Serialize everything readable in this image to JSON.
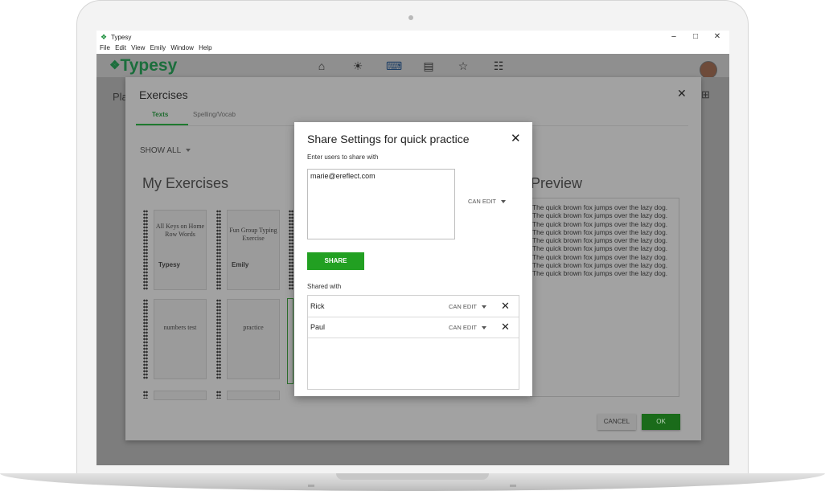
{
  "window": {
    "title": "Typesy",
    "menu": [
      "File",
      "Edit",
      "View",
      "Emily",
      "Window",
      "Help"
    ],
    "controls": {
      "minimize": "−",
      "maximize": "□",
      "close": "✕"
    }
  },
  "app": {
    "logo": "Typesy",
    "nav_icons": [
      "home-icon",
      "lightbulb-icon",
      "keyboard-icon",
      "chart-icon",
      "star-icon",
      "clipboard-icon"
    ],
    "page_title_partial": "Pla"
  },
  "exercises": {
    "title": "Exercises",
    "tabs": [
      "Texts",
      "Spelling/Vocab"
    ],
    "filter": "SHOW ALL",
    "section_title": "My Exercises",
    "cards": [
      {
        "title": "All Keys on Home Row Words",
        "author": "Typesy"
      },
      {
        "title": "Fun Group Typing Exercise",
        "author": "Emily"
      },
      {
        "title": "numbers test",
        "author": ""
      },
      {
        "title": "practice",
        "author": ""
      }
    ],
    "preview_title": "Preview",
    "preview_text": "The quick brown fox jumps over the lazy dog. The quick brown fox jumps over the lazy dog. The quick brown fox jumps over the lazy dog. The quick brown fox jumps over the lazy dog. The quick brown fox jumps over the lazy dog. The quick brown fox jumps over the lazy dog. The quick brown fox jumps over the lazy dog. The quick brown fox jumps over the lazy dog. The quick brown fox jumps over the lazy dog.",
    "cancel_label": "CANCEL",
    "ok_label": "OK",
    "close": "✕"
  },
  "share_dialog": {
    "title": "Share Settings for quick practice",
    "close": "✕",
    "enter_label": "Enter users to share with",
    "email_value": "marie@ereflect.com",
    "new_permission": "CAN EDIT",
    "share_label": "SHARE",
    "shared_with_label": "Shared with",
    "shared": [
      {
        "name": "Rick",
        "permission": "CAN EDIT",
        "remove": "✕"
      },
      {
        "name": "Paul",
        "permission": "CAN EDIT",
        "remove": "✕"
      }
    ]
  },
  "colors": {
    "accent_green": "#22a022",
    "brand_green": "#1b6e3c",
    "overlay_gray": "#7d7d7d"
  }
}
